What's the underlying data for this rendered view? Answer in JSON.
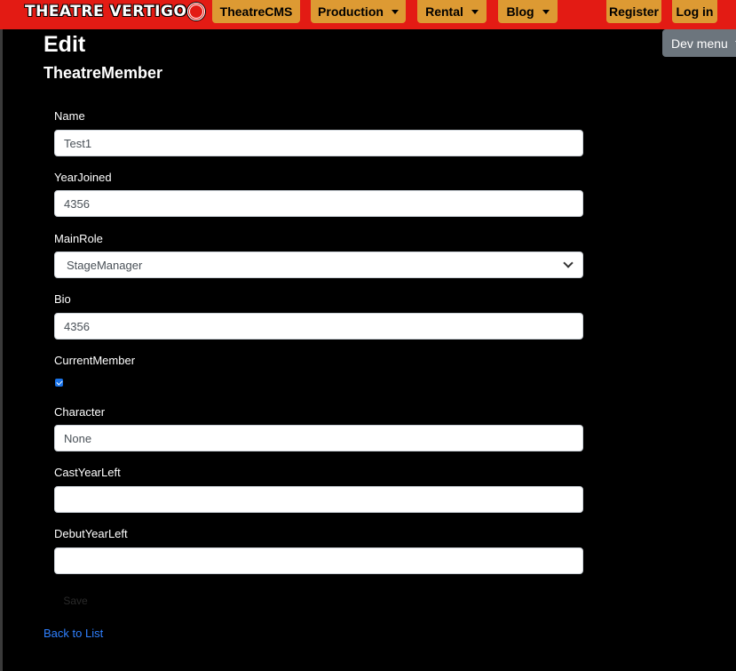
{
  "brand": {
    "name": "THEATRE VERTIGO"
  },
  "nav": {
    "items": [
      {
        "label": "TheatreCMS",
        "dropdown": false
      },
      {
        "label": "Production",
        "dropdown": true
      },
      {
        "label": "Rental",
        "dropdown": true
      },
      {
        "label": "Blog",
        "dropdown": true
      }
    ],
    "register": "Register",
    "login": "Log in",
    "dev_menu": "Dev menu"
  },
  "page": {
    "title": "Edit",
    "subtitle": "TheatreMember"
  },
  "form": {
    "name": {
      "label": "Name",
      "value": "Test1"
    },
    "year_joined": {
      "label": "YearJoined",
      "value": "4356"
    },
    "main_role": {
      "label": "MainRole",
      "value": "StageManager"
    },
    "bio": {
      "label": "Bio",
      "value": "4356"
    },
    "current_member": {
      "label": "CurrentMember",
      "checked": true
    },
    "character": {
      "label": "Character",
      "value": "None"
    },
    "cast_year_left": {
      "label": "CastYearLeft",
      "value": ""
    },
    "debut_year_left": {
      "label": "DebutYearLeft",
      "value": ""
    },
    "save": "Save"
  },
  "back_link": "Back to List",
  "colors": {
    "navbar": "#e31b14",
    "nav_button": "#dd9a33",
    "link": "#2f80ff"
  }
}
